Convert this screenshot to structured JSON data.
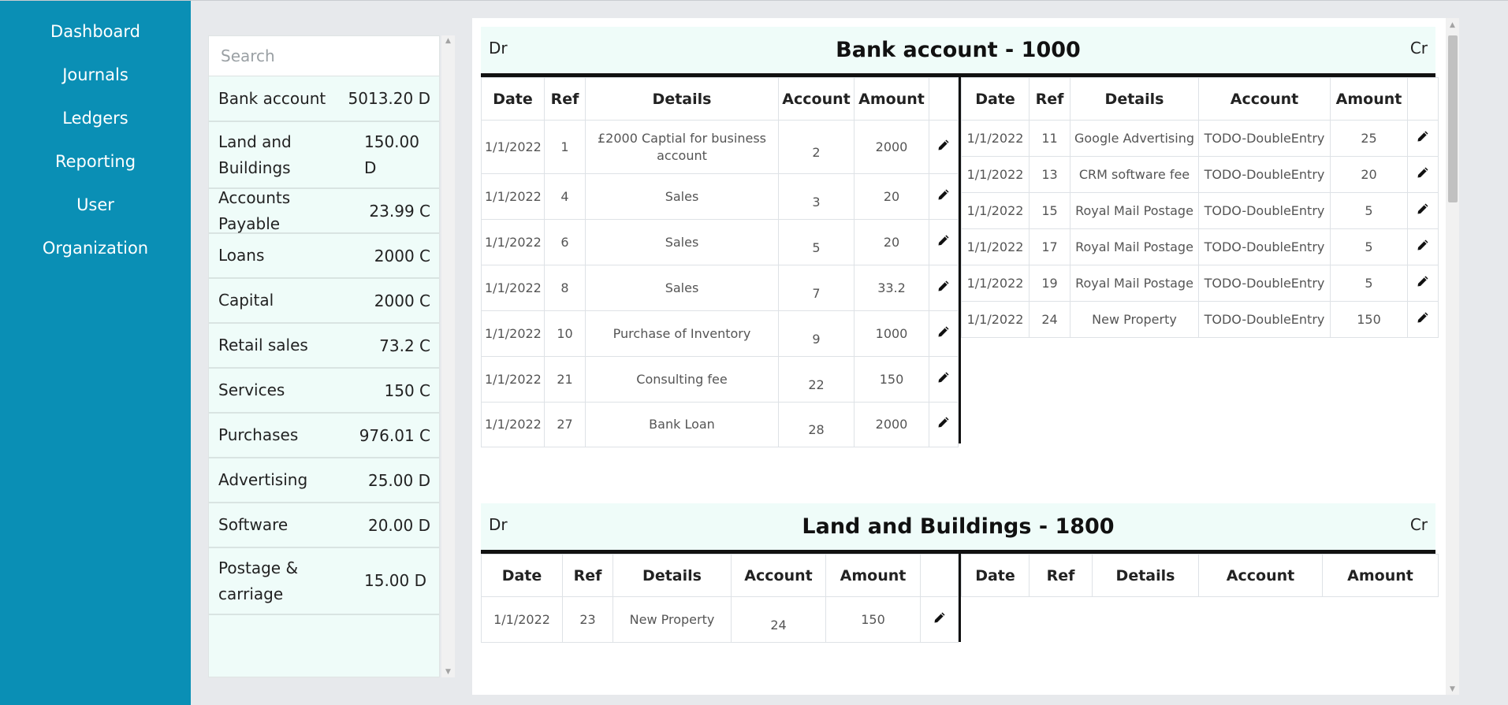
{
  "nav": [
    "Dashboard",
    "Journals",
    "Ledgers",
    "Reporting",
    "User",
    "Organization"
  ],
  "search": {
    "placeholder": "Search"
  },
  "accounts": [
    {
      "name": "Bank account",
      "balance": "5013.20 D"
    },
    {
      "name": "Land and Buildings",
      "balance": "150.00 D"
    },
    {
      "name": "Accounts Payable",
      "balance": "23.99 C"
    },
    {
      "name": "Loans",
      "balance": "2000 C"
    },
    {
      "name": "Capital",
      "balance": "2000 C"
    },
    {
      "name": "Retail sales",
      "balance": "73.2 C"
    },
    {
      "name": "Services",
      "balance": "150 C"
    },
    {
      "name": "Purchases",
      "balance": "976.01 C"
    },
    {
      "name": "Advertising",
      "balance": "25.00 D"
    },
    {
      "name": "Software",
      "balance": "20.00 D"
    },
    {
      "name": "Postage & carriage",
      "balance": "15.00 D"
    }
  ],
  "ledger_labels": {
    "dr": "Dr",
    "cr": "Cr"
  },
  "columns": [
    "Date",
    "Ref",
    "Details",
    "Account",
    "Amount"
  ],
  "ledgers": [
    {
      "title": "Bank account - 1000",
      "debit": [
        {
          "date": "1/1/2022",
          "ref": "1",
          "details": "£2000 Captial for business account",
          "account": "2",
          "amount": "2000"
        },
        {
          "date": "1/1/2022",
          "ref": "4",
          "details": "Sales",
          "account": "3",
          "amount": "20"
        },
        {
          "date": "1/1/2022",
          "ref": "6",
          "details": "Sales",
          "account": "5",
          "amount": "20"
        },
        {
          "date": "1/1/2022",
          "ref": "8",
          "details": "Sales",
          "account": "7",
          "amount": "33.2"
        },
        {
          "date": "1/1/2022",
          "ref": "10",
          "details": "Purchase of Inventory",
          "account": "9",
          "amount": "1000"
        },
        {
          "date": "1/1/2022",
          "ref": "21",
          "details": "Consulting fee",
          "account": "22",
          "amount": "150"
        },
        {
          "date": "1/1/2022",
          "ref": "27",
          "details": "Bank Loan",
          "account": "28",
          "amount": "2000"
        }
      ],
      "credit": [
        {
          "date": "1/1/2022",
          "ref": "11",
          "details": "Google Advertising",
          "account": "TODO-DoubleEntry",
          "amount": "25"
        },
        {
          "date": "1/1/2022",
          "ref": "13",
          "details": "CRM software fee",
          "account": "TODO-DoubleEntry",
          "amount": "20"
        },
        {
          "date": "1/1/2022",
          "ref": "15",
          "details": "Royal Mail Postage",
          "account": "TODO-DoubleEntry",
          "amount": "5"
        },
        {
          "date": "1/1/2022",
          "ref": "17",
          "details": "Royal Mail Postage",
          "account": "TODO-DoubleEntry",
          "amount": "5"
        },
        {
          "date": "1/1/2022",
          "ref": "19",
          "details": "Royal Mail Postage",
          "account": "TODO-DoubleEntry",
          "amount": "5"
        },
        {
          "date": "1/1/2022",
          "ref": "24",
          "details": "New Property",
          "account": "TODO-DoubleEntry",
          "amount": "150"
        }
      ]
    },
    {
      "title": "Land and Buildings - 1800",
      "debit": [
        {
          "date": "1/1/2022",
          "ref": "23",
          "details": "New Property",
          "account": "24",
          "amount": "150"
        }
      ],
      "credit": []
    }
  ]
}
